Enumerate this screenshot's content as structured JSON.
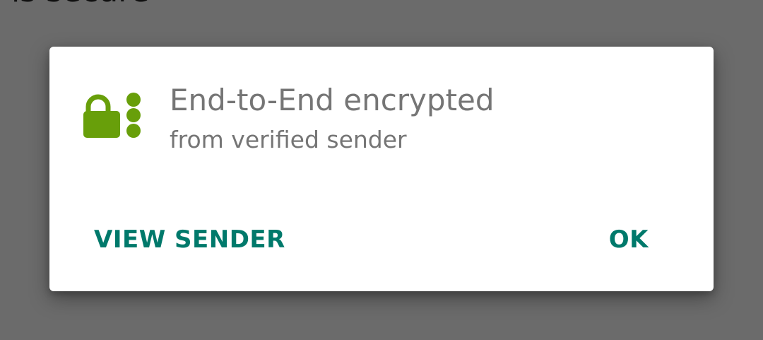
{
  "background": {
    "partial_text": "is secure"
  },
  "dialog": {
    "icon": "lock-with-dots-icon",
    "icon_color": "#689f0a",
    "title": "End-to-End encrypted",
    "subtitle": "from verified sender",
    "text_color": "#757575",
    "buttons": {
      "view_sender": "VIEW SENDER",
      "ok": "OK"
    },
    "button_color": "#00796b"
  }
}
